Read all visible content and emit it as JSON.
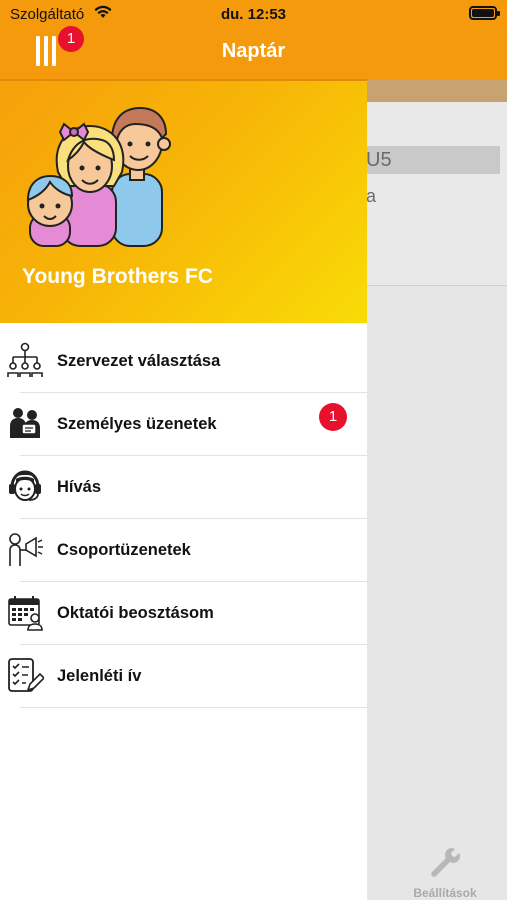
{
  "status_bar": {
    "carrier": "Szolgáltató",
    "time": "du. 12:53"
  },
  "header": {
    "title": "Naptár",
    "menu_badge": "1"
  },
  "drawer": {
    "organization": "Young Brothers FC",
    "items": [
      {
        "label": "Szervezet választása",
        "icon": "org-chart-icon"
      },
      {
        "label": "Személyes üzenetek",
        "icon": "people-chat-icon",
        "badge": "1"
      },
      {
        "label": "Hívás",
        "icon": "headset-operator-icon"
      },
      {
        "label": "Csoportüzenetek",
        "icon": "megaphone-person-icon"
      },
      {
        "label": "Oktatói beosztásom",
        "icon": "calendar-person-icon"
      },
      {
        "label": "Jelenléti ív",
        "icon": "checklist-pen-icon"
      }
    ]
  },
  "background": {
    "event_title_partial": "U5",
    "event_sub_partial": "a",
    "tab_settings_label": "Beállítások"
  },
  "colors": {
    "accent": "#f59a0c",
    "badge": "#e8112d"
  }
}
